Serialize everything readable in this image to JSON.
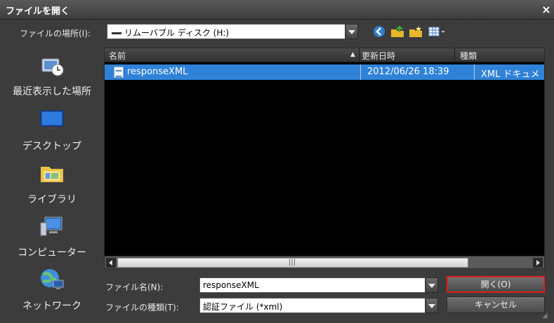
{
  "window": {
    "title": "ファイルを開く",
    "close_glyph": "×"
  },
  "lookin": {
    "label": "ファイルの場所(I):",
    "value": "リムーバブル ディスク (H:)"
  },
  "toolbar": {
    "icons": [
      "back-icon",
      "up-folder-icon",
      "new-folder-icon",
      "view-menu-icon"
    ]
  },
  "places": [
    {
      "label": "最近表示した場所",
      "icon": "recent-places-icon"
    },
    {
      "label": "デスクトップ",
      "icon": "desktop-icon"
    },
    {
      "label": "ライブラリ",
      "icon": "libraries-icon"
    },
    {
      "label": "コンピューター",
      "icon": "computer-icon"
    },
    {
      "label": "ネットワーク",
      "icon": "network-icon"
    }
  ],
  "list": {
    "columns": [
      {
        "label": "名前"
      },
      {
        "label": "更新日時",
        "sort": "▲"
      },
      {
        "label": "種類"
      }
    ],
    "rows": [
      {
        "name": "responseXML",
        "modified": "2012/06/26 18:39",
        "type": "XML ドキュメ"
      }
    ]
  },
  "filename": {
    "label": "ファイル名(N):",
    "value": "responseXML"
  },
  "filetype": {
    "label": "ファイルの種類(T):",
    "value": "認証ファイル (*xml)"
  },
  "buttons": {
    "open": "開く(O)",
    "cancel": "キャンセル"
  },
  "colors": {
    "selection": "#2f82d8",
    "highlight_border": "#e02020",
    "background": "#3c3c3c"
  }
}
